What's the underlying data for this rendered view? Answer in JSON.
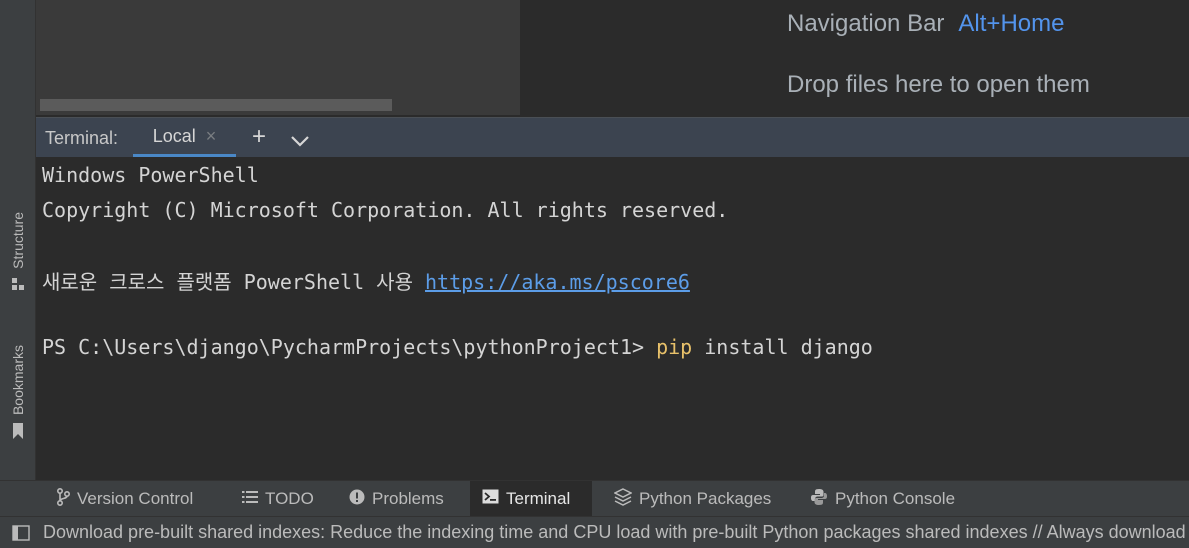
{
  "left_strip": {
    "structure_label": "Structure",
    "bookmarks_label": "Bookmarks"
  },
  "empty_hints": {
    "nav_label": "Navigation Bar",
    "nav_shortcut": "Alt+Home",
    "drop_label": "Drop files here to open them"
  },
  "terminal": {
    "title": "Terminal:",
    "tab_label": "Local",
    "tab_close": "×",
    "add_symbol": "+",
    "lines": {
      "l1": "Windows PowerShell",
      "l2": "Copyright (C) Microsoft Corporation. All rights reserved.",
      "l3_text": "새로운 크로스 플랫폼 PowerShell 사용 ",
      "l3_link": "https://aka.ms/pscore6",
      "prompt": "PS C:\\Users\\django\\PycharmProjects\\pythonProject1> ",
      "cmd": "pip",
      "args": " install django"
    }
  },
  "toolwindows": [
    {
      "label": "Version Control",
      "icon": "version-control-icon"
    },
    {
      "label": "TODO",
      "icon": "todo-list-icon"
    },
    {
      "label": "Problems",
      "icon": "problems-icon"
    },
    {
      "label": "Terminal",
      "icon": "terminal-icon",
      "active": true
    },
    {
      "label": "Python Packages",
      "icon": "packages-icon"
    },
    {
      "label": "Python Console",
      "icon": "python-icon"
    }
  ],
  "status": {
    "message": "Download pre-built shared indexes: Reduce the indexing time and CPU load with pre-built Python packages shared indexes // Always download"
  },
  "colors": {
    "accent": "#4a88c7",
    "link": "#5c9de8",
    "command": "#e8c16a"
  }
}
